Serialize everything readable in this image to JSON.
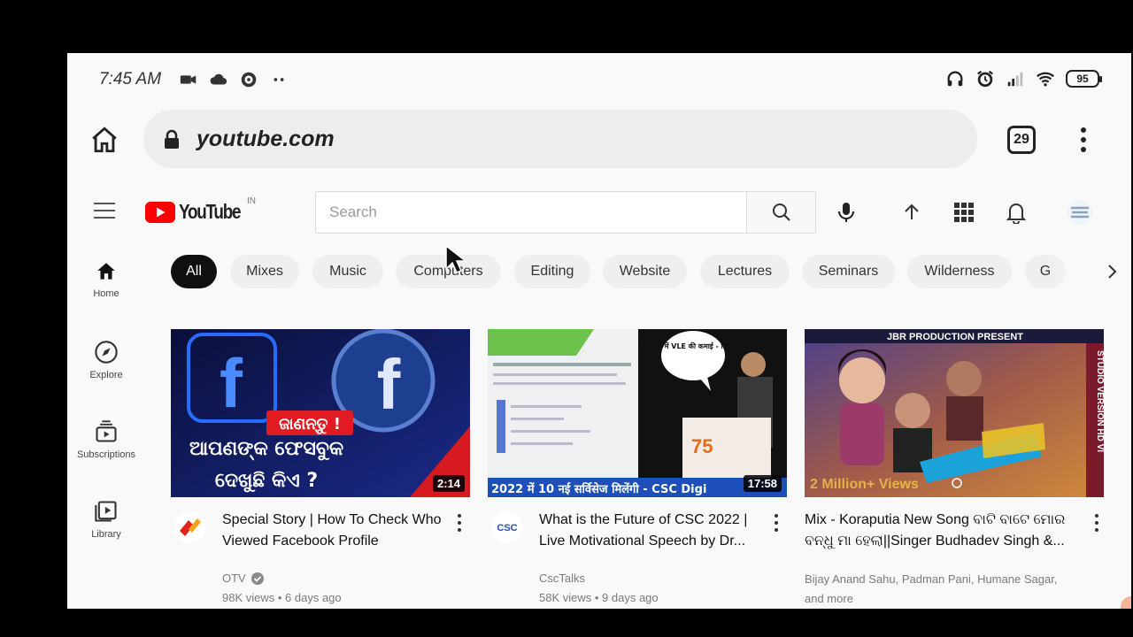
{
  "status_bar": {
    "time": "7:45 AM",
    "battery": "95"
  },
  "browser": {
    "url": "youtube.com",
    "tab_count": "29"
  },
  "youtube": {
    "logo_text": "YouTube",
    "region": "IN",
    "search_placeholder": "Search",
    "sidebar": [
      {
        "label": "Home",
        "icon": "home-icon"
      },
      {
        "label": "Explore",
        "icon": "compass-icon"
      },
      {
        "label": "Subscriptions",
        "icon": "subscriptions-icon"
      },
      {
        "label": "Library",
        "icon": "library-icon"
      }
    ],
    "chips": [
      "All",
      "Mixes",
      "Music",
      "Computers",
      "Editing",
      "Website",
      "Lectures",
      "Seminars",
      "Wilderness",
      "G"
    ],
    "videos": [
      {
        "title": "Special Story | How To Check Who Viewed Facebook Profile",
        "channel": "OTV",
        "views": "98K views",
        "age": "6 days ago",
        "duration": "2:14",
        "thumb_text_1": "ଜାଣନ୍ତୁ !",
        "thumb_text_2": "ଆପଣଙ୍କ ଫେସବୁକ",
        "thumb_text_3": "ଦେଖୁଛି କିଏ ?"
      },
      {
        "title": "What is the Future of CSC 2022 | Live Motivational Speech by Dr...",
        "channel": "CscTalks",
        "views": "58K views",
        "age": "9 days ago",
        "duration": "17:58",
        "thumb_banner": "2022 में 10 नई सर्विसेज मिलेंगी - CSC Digi",
        "thumb_bubble": "2022 में VLE की कमाई - कितनी !"
      },
      {
        "title": "Mix - Koraputia New Song ବାଟି ବାଟେ ମୋର ବନ୍ଧୁ ମା ହେଲା||Singer Budhadev Singh &...",
        "channel": "Bijay Anand Sahu, Padman Pani, Humane Sagar, and more",
        "thumb_header": "JBR PRODUCTION PRESENT",
        "thumb_side": "STUDIO VERSION HD VI",
        "thumb_views": "2 Million+ Views"
      }
    ]
  }
}
